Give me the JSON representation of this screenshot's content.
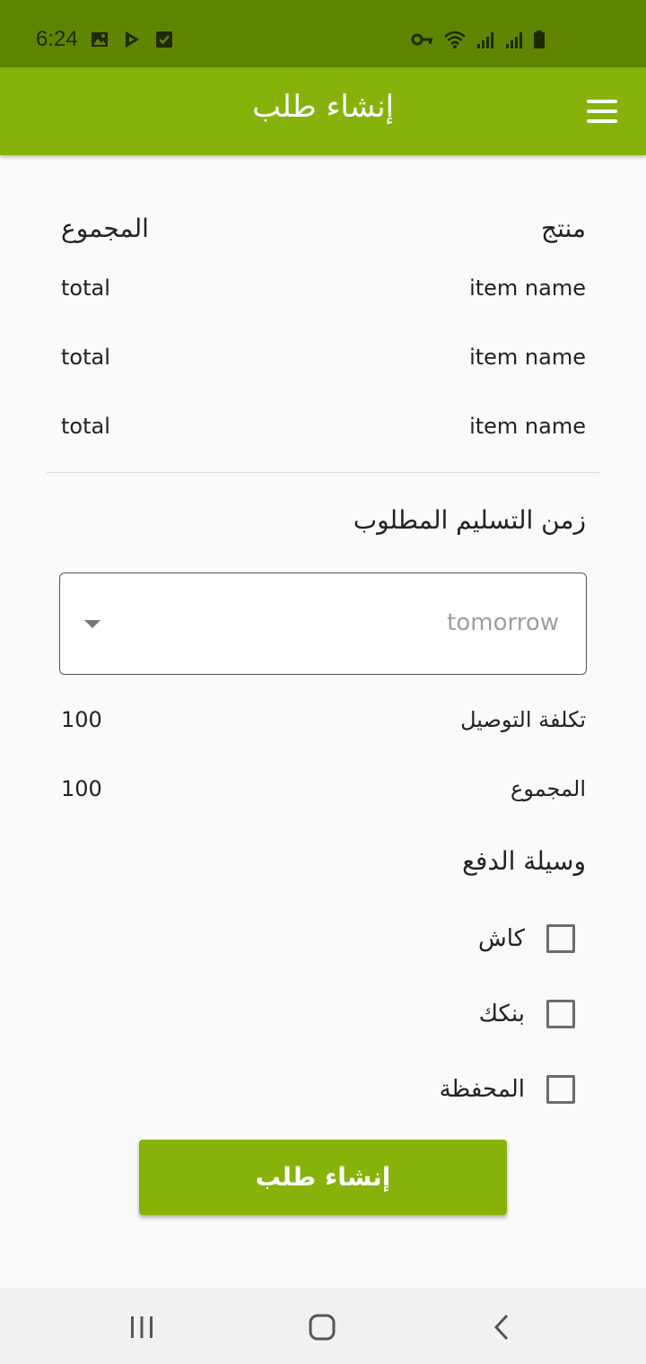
{
  "status_bar": {
    "time": "6:24",
    "left_icons": [
      "image-icon",
      "play-store-icon",
      "checkbox-notification-icon"
    ],
    "right_icons": [
      "vpn-key-icon",
      "wifi-icon",
      "signal-icon",
      "signal-icon",
      "battery-icon"
    ]
  },
  "app_bar": {
    "title": "إنشاء طلب",
    "menu_icon": "hamburger-menu-icon"
  },
  "table": {
    "headers": {
      "product": "منتج",
      "total": "المجموع"
    },
    "rows": [
      {
        "item": "item name",
        "total": "total"
      },
      {
        "item": "item name",
        "total": "total"
      },
      {
        "item": "item name",
        "total": "total"
      }
    ]
  },
  "delivery": {
    "label": "زمن التسليم المطلوب",
    "selected": "tomorrow"
  },
  "summary": {
    "delivery_cost_label": "تكلفة التوصيل",
    "delivery_cost_value": "100",
    "total_label": "المجموع",
    "total_value": "100"
  },
  "payment": {
    "label": "وسيلة الدفع",
    "options": [
      {
        "label": "كاش",
        "checked": false
      },
      {
        "label": "بنكك",
        "checked": false
      },
      {
        "label": "المحفظة",
        "checked": false
      }
    ]
  },
  "actions": {
    "submit_label": "إنشاء طلب"
  },
  "colors": {
    "status_bar": "#5f8500",
    "primary": "#86b20a",
    "background": "#fafafa"
  },
  "nav_bar": {
    "icons": [
      "recent-apps-icon",
      "home-icon",
      "back-icon"
    ]
  }
}
